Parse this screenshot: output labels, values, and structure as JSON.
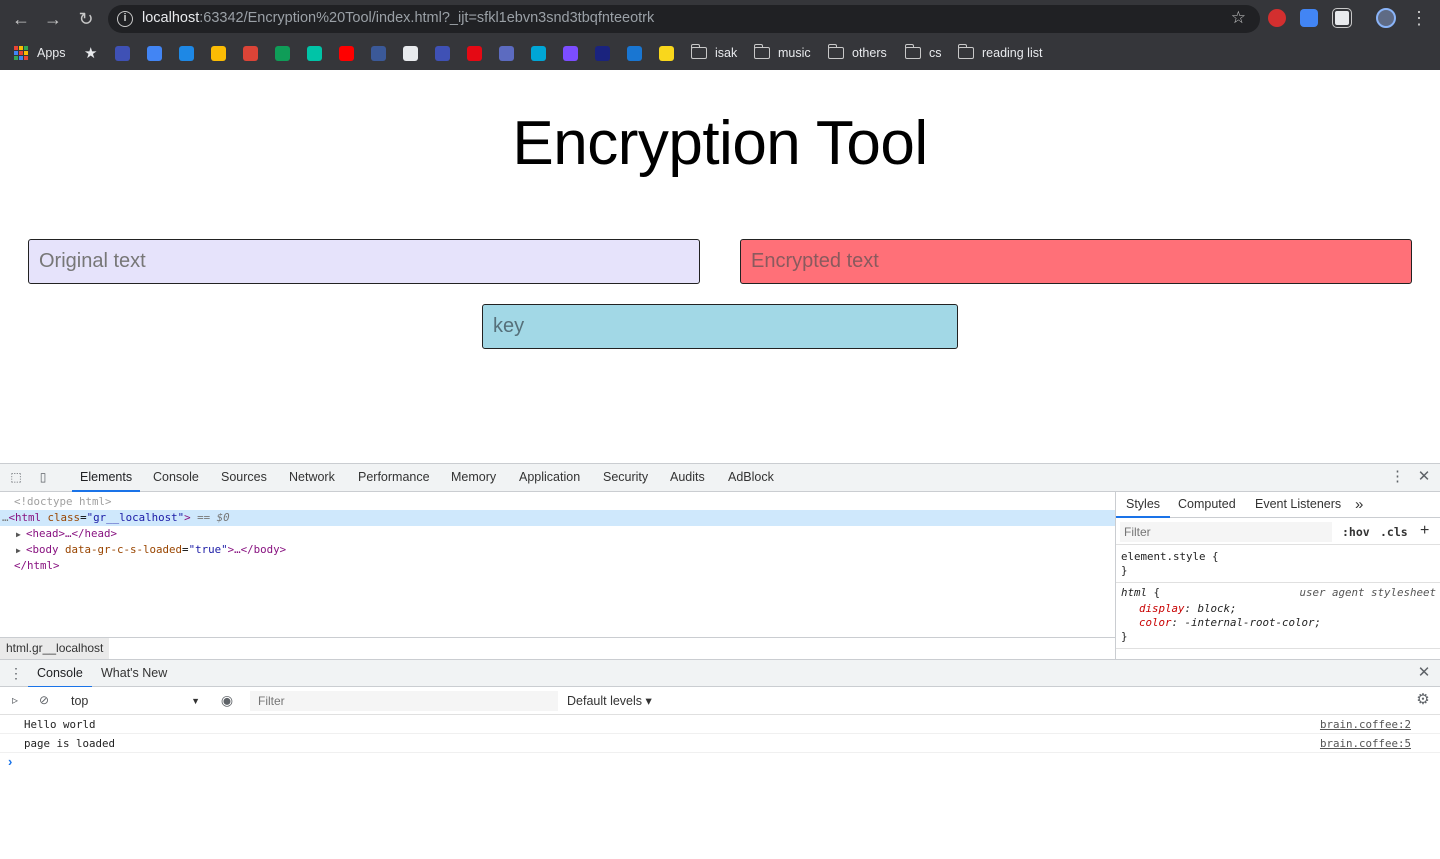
{
  "browser": {
    "url_host": "localhost",
    "url_rest": ":63342/Encryption%20Tool/index.html?_ijt=sfkl1ebvn3snd3tbqfnteeotrk",
    "bookmarks": {
      "apps_label": "Apps",
      "folders": [
        "isak",
        "music",
        "others",
        "cs",
        "reading list"
      ],
      "icon_colors": [
        "#3f51b5",
        "#4285f4",
        "#1e88e5",
        "#fbbc04",
        "#db4437",
        "#0f9d58",
        "#00c4a7",
        "#ff0000",
        "#3b5998",
        "#e8eaed",
        "#3f51b5",
        "#e50914",
        "#5c6bc0",
        "#00a6d6",
        "#7c4dff",
        "#1a237e",
        "#1976d2",
        "#f9d71c"
      ]
    }
  },
  "page": {
    "title": "Encryption Tool",
    "original_placeholder": "Original text",
    "encrypted_placeholder": "Encrypted text",
    "key_placeholder": "key"
  },
  "devtools": {
    "tabs": [
      "Elements",
      "Console",
      "Sources",
      "Network",
      "Performance",
      "Memory",
      "Application",
      "Security",
      "Audits",
      "AdBlock"
    ],
    "elements": {
      "doctype": "<!doctype html>",
      "html_open_tag": "<html",
      "html_attr": "class",
      "html_attr_val": "\"gr__localhost\"",
      "html_close_bracket": ">",
      "selected_note": "== $0",
      "head": "<head>…</head>",
      "body_open": "<body",
      "body_attr": "data-gr-c-s-loaded",
      "body_attr_val": "\"true\"",
      "body_rest": ">…</body>",
      "html_close": "</html>"
    },
    "breadcrumb": "html.gr__localhost",
    "styles": {
      "tabs": [
        "Styles",
        "Computed",
        "Event Listeners"
      ],
      "filter_placeholder": "Filter",
      "hov": ":hov",
      "cls": ".cls",
      "element_style_open": "element.style {",
      "close_brace": "}",
      "html_selector": "html",
      "html_open_brace": " {",
      "ua_label": "user agent stylesheet",
      "decl1_prop": "display",
      "decl1_val": " block;",
      "decl2_prop": "color",
      "decl2_val": " -internal-root-color;"
    },
    "drawer": {
      "tabs": [
        "Console",
        "What's New"
      ],
      "context": "top",
      "filter_placeholder": "Filter",
      "levels": "Default levels ▾",
      "messages": [
        {
          "text": "Hello world",
          "source": "brain.coffee:2"
        },
        {
          "text": "page is loaded",
          "source": "brain.coffee:5"
        }
      ]
    }
  }
}
